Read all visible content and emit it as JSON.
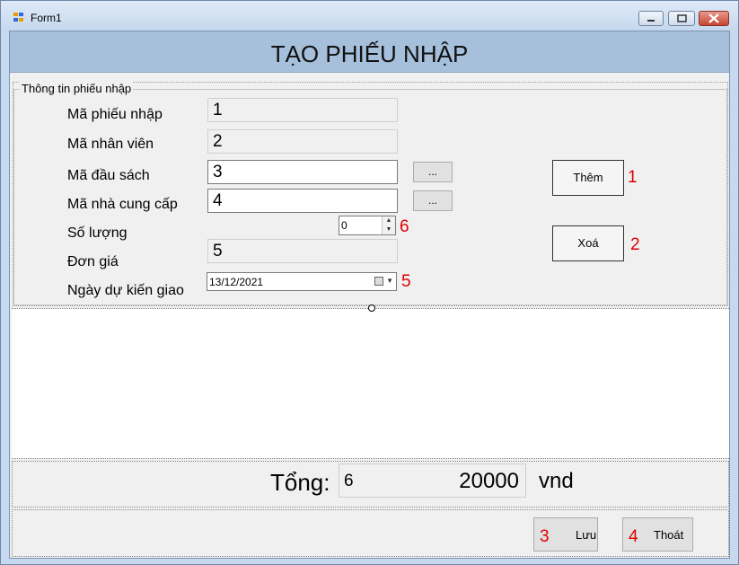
{
  "window": {
    "title": "Form1",
    "controls": {
      "minimize": "minimize-icon",
      "maximize": "maximize-icon",
      "close": "close-icon"
    }
  },
  "header": {
    "title": "TẠO PHIẾU NHẬP"
  },
  "group": {
    "legend": "Thông tin phiếu nhập",
    "fields": {
      "ma_phieu_nhap": {
        "label": "Mã phiếu nhập",
        "value": "1"
      },
      "ma_nhan_vien": {
        "label": "Mã nhân viên",
        "value": "2"
      },
      "ma_dau_sach": {
        "label": "Mã đầu sách",
        "value": "3"
      },
      "ma_nha_cung_cap": {
        "label": "Mã nhà cung cấp",
        "value": "4"
      },
      "so_luong": {
        "label": "Số lượng",
        "value": "0",
        "tag": "6"
      },
      "don_gia": {
        "label": "Đơn giá",
        "value": "5"
      },
      "ngay_du_kien_giao": {
        "label": "Ngày dự kiến giao",
        "value": "13/12/2021",
        "tag": "5"
      }
    },
    "browse_label": "...",
    "buttons": {
      "them": {
        "label": "Thêm",
        "tag": "1"
      },
      "xoa": {
        "label": "Xoá",
        "tag": "2"
      }
    }
  },
  "total": {
    "label": "Tổng:",
    "left_value": "6",
    "value": "20000",
    "unit": "vnd"
  },
  "bottom": {
    "luu": {
      "label": "Lưu",
      "tag": "3"
    },
    "thoat": {
      "label": "Thoát",
      "tag": "4"
    }
  },
  "colors": {
    "header_bg": "#a6bfdb",
    "annotation_red": "#e00000",
    "form_bg": "#f0f0f0"
  }
}
